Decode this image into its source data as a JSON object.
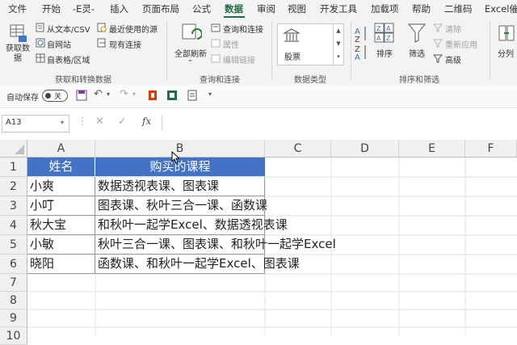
{
  "menu": {
    "tabs": [
      "文件",
      "开始",
      "-E灵-",
      "插入",
      "页面布局",
      "公式",
      "数据",
      "审阅",
      "视图",
      "开发工具",
      "加载项",
      "帮助",
      "二维码",
      "Excel催"
    ],
    "active_index": 6
  },
  "ribbon": {
    "get_data": "获取数\n据",
    "from_text_csv": "从文本/CSV",
    "from_web": "自网站",
    "from_table": "自表格/区域",
    "recent_sources": "最近使用的源",
    "existing_connections": "现有连接",
    "group_get_transform": "获取和转换数据",
    "refresh_all": "全部刷新",
    "queries_connections": "查询和连接",
    "properties": "属性",
    "edit_links": "编辑链接",
    "group_queries": "查询和连接",
    "stocks": "股票",
    "group_data_types": "数据类型",
    "sort": "排序",
    "filter": "筛选",
    "clear": "清除",
    "reapply": "重新应用",
    "advanced": "高级",
    "group_sort_filter": "排序和筛选",
    "split": "分列",
    "accent_color": "#1f6e43"
  },
  "qat": {
    "autosave_label": "自动保存",
    "autosave_state": "关"
  },
  "formula_bar": {
    "name_box": "A13",
    "fx": "fx",
    "content": ""
  },
  "sheet": {
    "columns": [
      "A",
      "B",
      "C",
      "D",
      "E",
      "F"
    ],
    "rows": [
      "1",
      "2",
      "3",
      "4",
      "5",
      "6",
      "7",
      "8",
      "9",
      "10"
    ],
    "header": [
      "姓名",
      "购买的课程"
    ],
    "data": [
      [
        "小爽",
        "数据透视表课、图表课"
      ],
      [
        "小叮",
        "图表课、秋叶三合一课、函数课"
      ],
      [
        "秋大宝",
        "和秋叶一起学Excel、数据透视表课"
      ],
      [
        "小敏",
        "秋叶三合一课、图表课、和秋叶一起学Excel"
      ],
      [
        "晓阳",
        "函数课、和秋叶一起学Excel、图表课"
      ]
    ],
    "header_color": "#4472c4"
  }
}
